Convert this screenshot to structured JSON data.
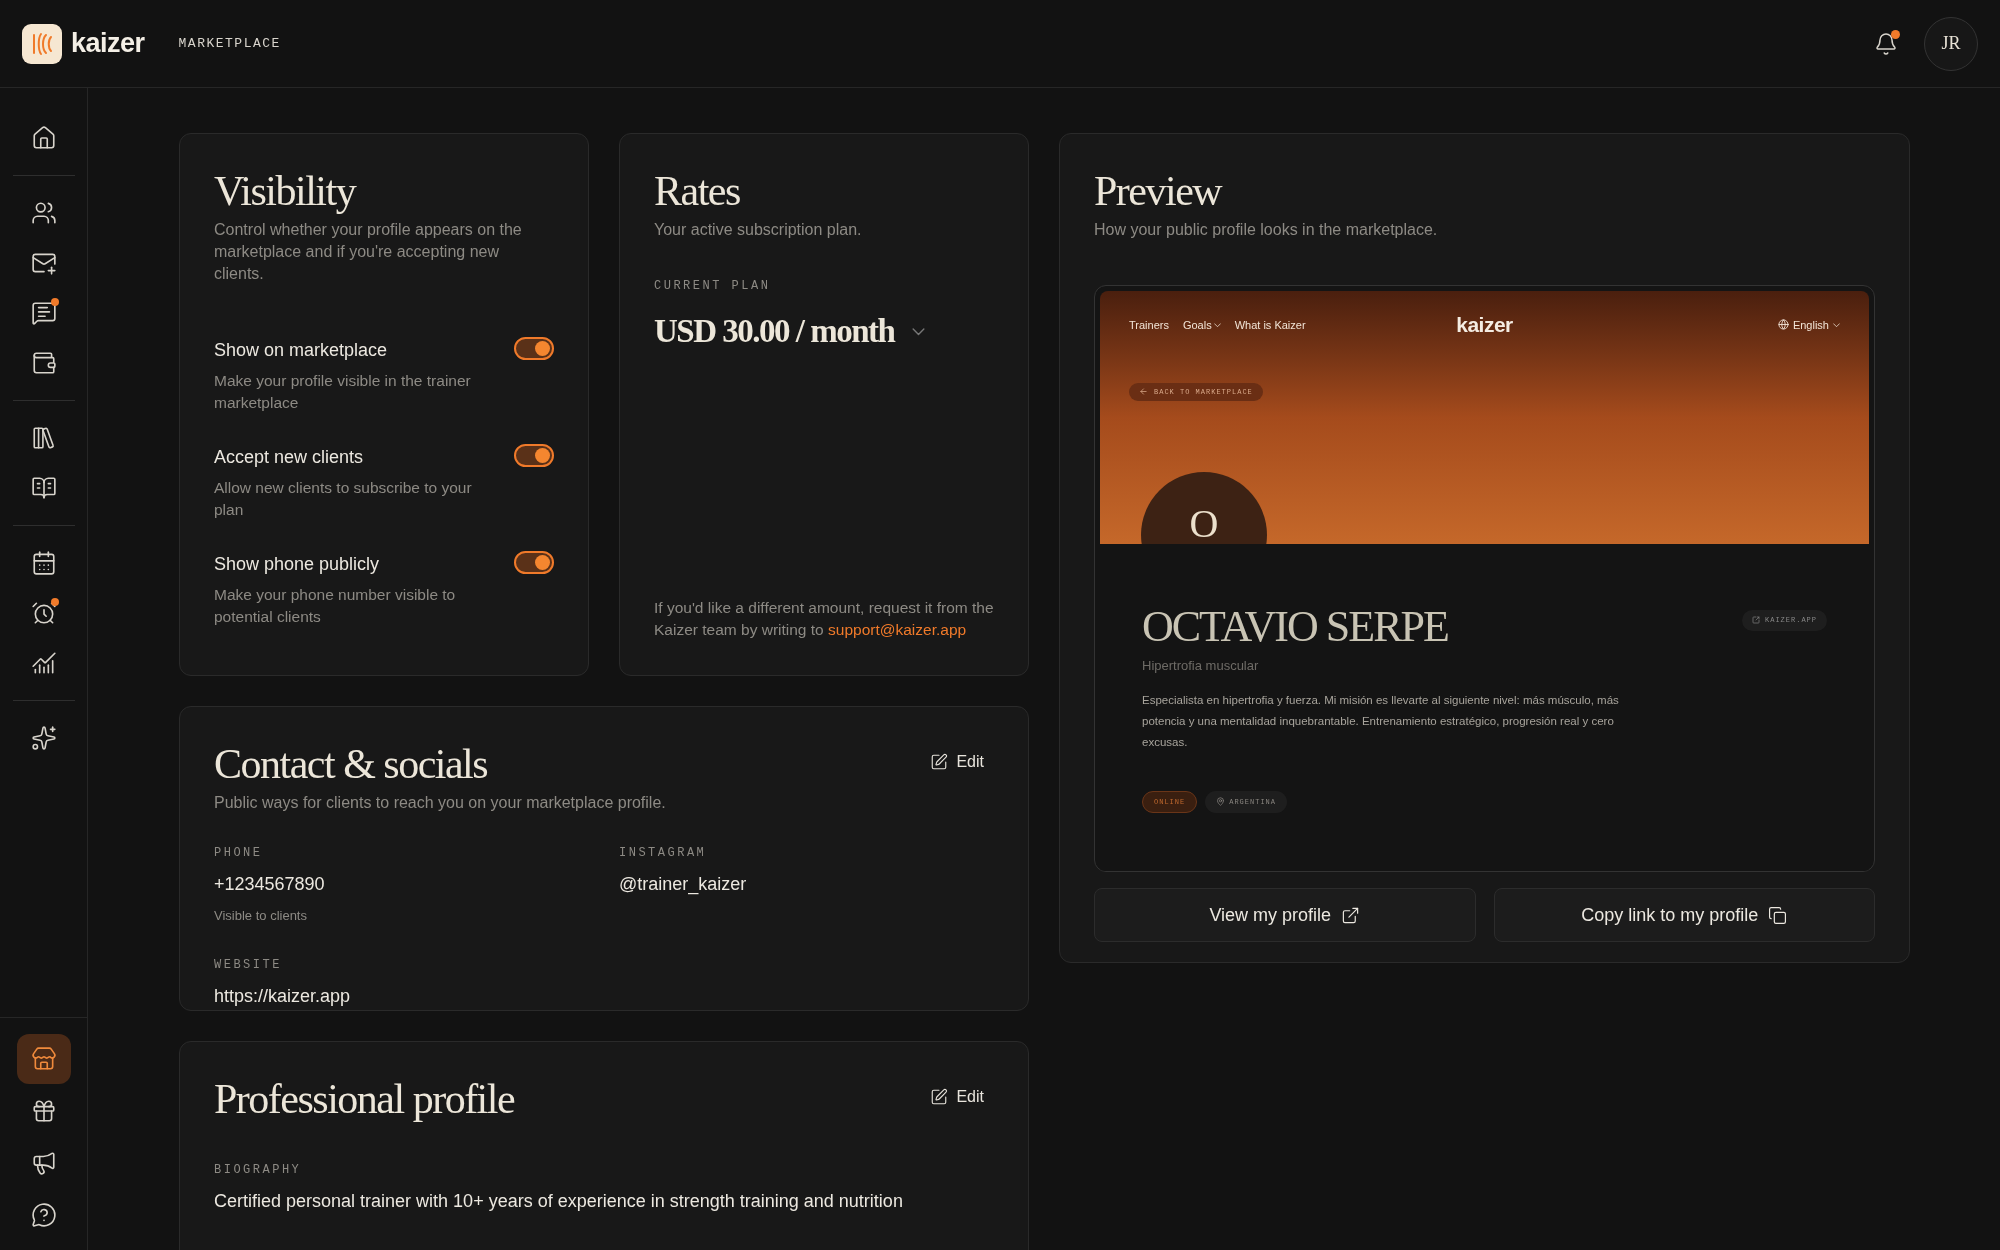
{
  "header": {
    "brand": "kaizer",
    "section": "MARKETPLACE",
    "notifications_unread": true,
    "avatar": "JR"
  },
  "sidebar": {
    "groups": [
      [
        {
          "selected": false,
          "badge": false
        }
      ],
      [
        {
          "selected": false,
          "badge": false
        },
        {
          "selected": false,
          "badge": false
        },
        {
          "selected": false,
          "badge": true
        },
        {
          "selected": false,
          "badge": false
        }
      ],
      [
        {
          "selected": false,
          "badge": false
        },
        {
          "selected": false,
          "badge": false
        }
      ],
      [
        {
          "selected": false,
          "badge": false
        },
        {
          "selected": false,
          "badge": true
        },
        {
          "selected": false,
          "badge": false
        }
      ],
      [
        {
          "selected": false,
          "badge": false
        }
      ]
    ],
    "bottom": [
      {
        "selected": true,
        "badge": false
      },
      {
        "selected": false,
        "badge": false
      },
      {
        "selected": false,
        "badge": false
      },
      {
        "selected": false,
        "badge": false
      }
    ]
  },
  "visibility": {
    "title": "Visibility",
    "subtitle": "Control whether your profile appears on the marketplace and if you're accepting new clients.",
    "settings": [
      {
        "label": "Show on marketplace",
        "description": "Make your profile visible in the trainer marketplace",
        "on": true
      },
      {
        "label": "Accept new clients",
        "description": "Allow new clients to subscribe to your plan",
        "on": true
      },
      {
        "label": "Show phone publicly",
        "description": "Make your phone number visible to potential clients",
        "on": true
      }
    ]
  },
  "rates": {
    "title": "Rates",
    "subtitle": "Your active subscription plan.",
    "plan_label": "CURRENT PLAN",
    "plan_value": "USD 30.00 / month",
    "note": "If you'd like a different amount, request it from the Kaizer team by writing to",
    "email": "support@kaizer.app"
  },
  "contact": {
    "title": "Contact & socials",
    "subtitle": "Public ways for clients to reach you on your marketplace profile.",
    "edit": "Edit",
    "fields": [
      {
        "label": "PHONE",
        "value": "+1234567890",
        "hint": "Visible to clients"
      },
      {
        "label": "INSTAGRAM",
        "value": "@trainer_kaizer"
      },
      {
        "label": "WEBSITE",
        "value": "https://kaizer.app"
      }
    ]
  },
  "professional": {
    "title": "Professional profile",
    "edit": "Edit",
    "fields": [
      {
        "label": "BIOGRAPHY",
        "value": "Certified personal trainer with 10+ years of experience in strength training and nutrition"
      }
    ]
  },
  "preview": {
    "title": "Preview",
    "subtitle": "How your public profile looks in the marketplace.",
    "page": {
      "nav": [
        {
          "label": "Trainers",
          "dropdown": false
        },
        {
          "label": "Goals",
          "dropdown": true
        },
        {
          "label": "What is Kaizer",
          "dropdown": false
        }
      ],
      "brand": "kaizer",
      "language": "English",
      "back": "BACK TO MARKETPLACE",
      "initial": "O",
      "name": "OCTAVIO SERPE",
      "specialty": "Hipertrofia muscular",
      "bio": "Especialista en hipertrofia y fuerza. Mi misión es llevarte al siguiente nivel: más músculo, más potencia y una mentalidad inquebrantable. Entrenamiento estratégico, progresión real y cero excusas.",
      "link": "KAIZER.APP",
      "tags": [
        {
          "label": "ONLINE",
          "kind": "status"
        },
        {
          "label": "ARGENTINA",
          "kind": "location"
        }
      ]
    },
    "buttons": [
      {
        "label": "View my profile",
        "kind": "open"
      },
      {
        "label": "Copy link to my profile",
        "kind": "copy"
      }
    ]
  }
}
